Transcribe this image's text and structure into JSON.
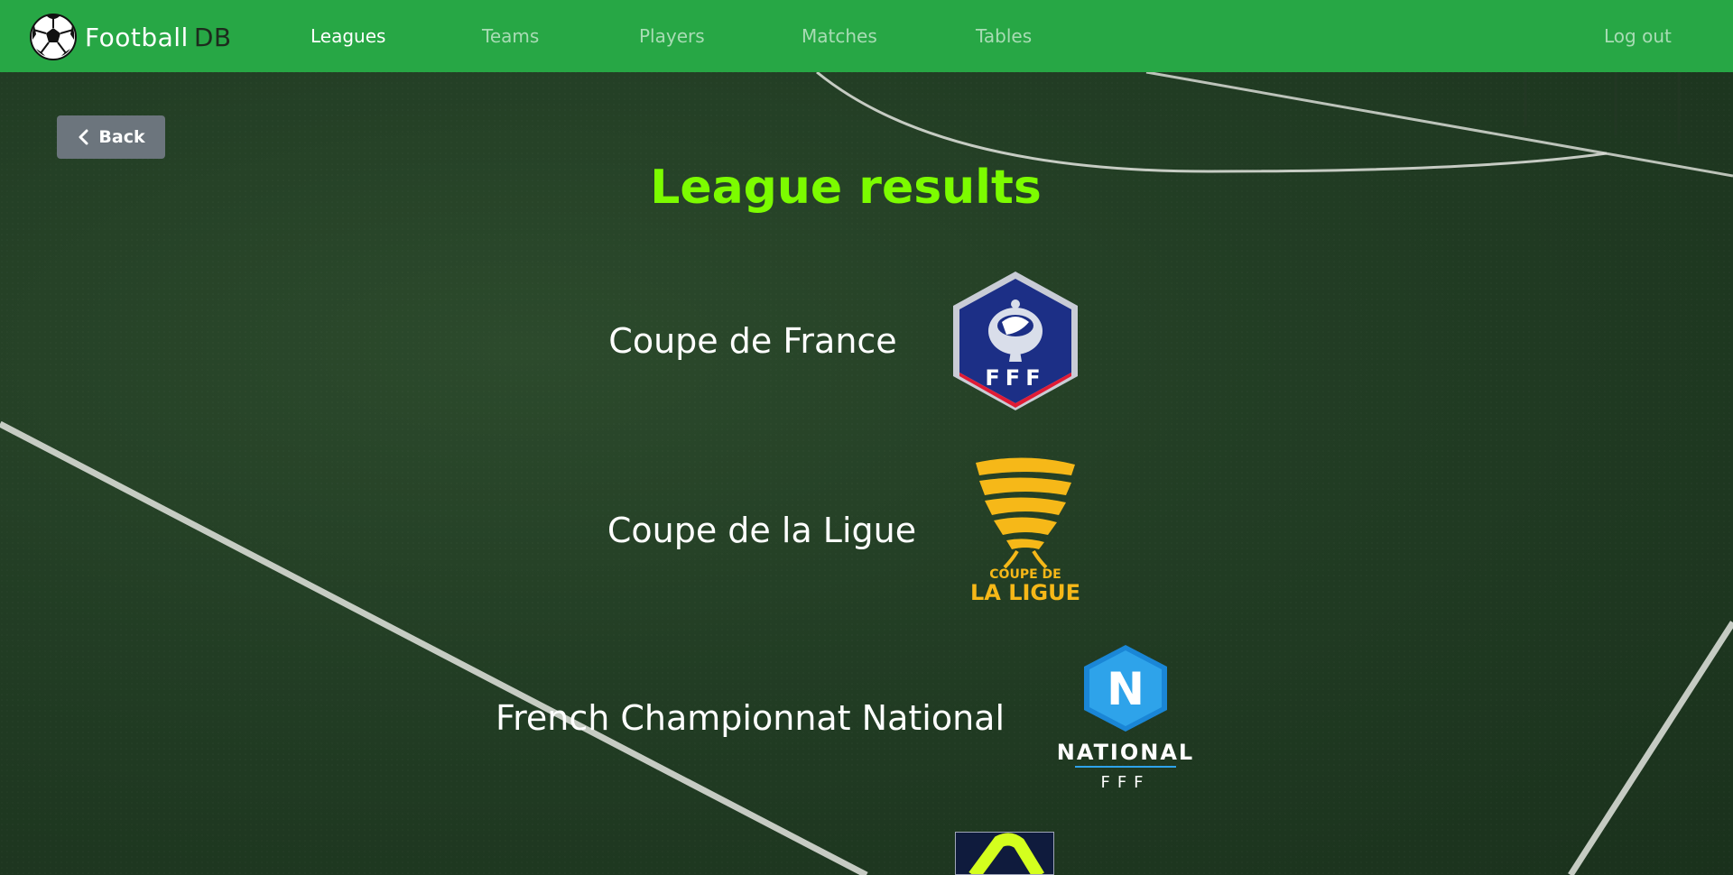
{
  "brand": {
    "name": "Football",
    "suffix": "DB"
  },
  "nav": {
    "items": [
      {
        "label": "Leagues",
        "active": true
      },
      {
        "label": "Teams",
        "active": false
      },
      {
        "label": "Players",
        "active": false
      },
      {
        "label": "Matches",
        "active": false
      },
      {
        "label": "Tables",
        "active": false
      }
    ],
    "logout": "Log out"
  },
  "back_label": "Back",
  "page_title": "League results",
  "leagues": [
    {
      "name": "Coupe de France",
      "logo": "fff-cup-logo",
      "logo_text": "FFF"
    },
    {
      "name": "Coupe de la Ligue",
      "logo": "coupe-de-la-ligue-logo",
      "logo_text_top": "COUPE DE",
      "logo_text_bottom": "LA LIGUE"
    },
    {
      "name": "French Championnat National",
      "logo": "national-logo",
      "logo_text": "NATIONAL",
      "logo_subtext": "FFF",
      "logo_letter": "N"
    }
  ],
  "colors": {
    "navbar": "#27a745",
    "title": "#7cfc00",
    "back_button": "#6c757d"
  }
}
